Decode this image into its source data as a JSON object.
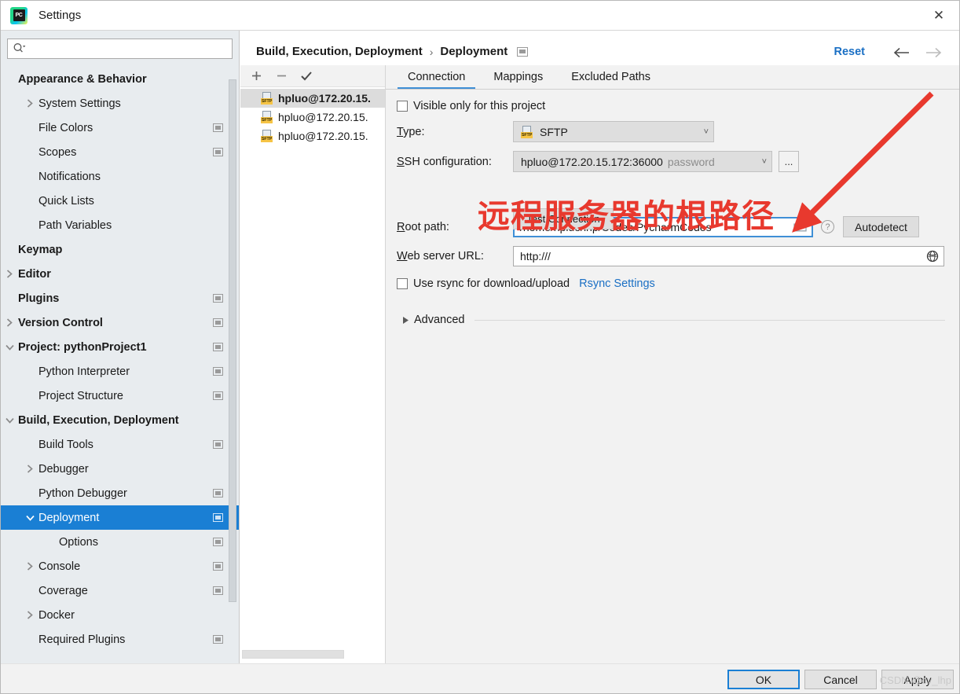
{
  "window": {
    "title": "Settings",
    "logo_text": "PC",
    "close_icon": "close-icon"
  },
  "sidebar": {
    "search": {
      "value": "",
      "placeholder": ""
    },
    "items": [
      {
        "label": "Appearance & Behavior",
        "bold": true,
        "indent": 0,
        "twisty": "none",
        "badge": false,
        "selected": false
      },
      {
        "label": "System Settings",
        "bold": false,
        "indent": 1,
        "twisty": "right",
        "badge": false,
        "selected": false
      },
      {
        "label": "File Colors",
        "bold": false,
        "indent": 1,
        "twisty": "none",
        "badge": true,
        "selected": false
      },
      {
        "label": "Scopes",
        "bold": false,
        "indent": 1,
        "twisty": "none",
        "badge": true,
        "selected": false
      },
      {
        "label": "Notifications",
        "bold": false,
        "indent": 1,
        "twisty": "none",
        "badge": false,
        "selected": false
      },
      {
        "label": "Quick Lists",
        "bold": false,
        "indent": 1,
        "twisty": "none",
        "badge": false,
        "selected": false
      },
      {
        "label": "Path Variables",
        "bold": false,
        "indent": 1,
        "twisty": "none",
        "badge": false,
        "selected": false
      },
      {
        "label": "Keymap",
        "bold": true,
        "indent": 0,
        "twisty": "none",
        "badge": false,
        "selected": false
      },
      {
        "label": "Editor",
        "bold": true,
        "indent": 0,
        "twisty": "right",
        "badge": false,
        "selected": false
      },
      {
        "label": "Plugins",
        "bold": true,
        "indent": 0,
        "twisty": "none",
        "badge": true,
        "selected": false
      },
      {
        "label": "Version Control",
        "bold": true,
        "indent": 0,
        "twisty": "right",
        "badge": true,
        "selected": false
      },
      {
        "label": "Project: pythonProject1",
        "bold": true,
        "indent": 0,
        "twisty": "down",
        "badge": true,
        "selected": false
      },
      {
        "label": "Python Interpreter",
        "bold": false,
        "indent": 1,
        "twisty": "none",
        "badge": true,
        "selected": false
      },
      {
        "label": "Project Structure",
        "bold": false,
        "indent": 1,
        "twisty": "none",
        "badge": true,
        "selected": false
      },
      {
        "label": "Build, Execution, Deployment",
        "bold": true,
        "indent": 0,
        "twisty": "down",
        "badge": false,
        "selected": false
      },
      {
        "label": "Build Tools",
        "bold": false,
        "indent": 1,
        "twisty": "none",
        "badge": true,
        "selected": false
      },
      {
        "label": "Debugger",
        "bold": false,
        "indent": 1,
        "twisty": "right",
        "badge": false,
        "selected": false
      },
      {
        "label": "Python Debugger",
        "bold": false,
        "indent": 1,
        "twisty": "none",
        "badge": true,
        "selected": false
      },
      {
        "label": "Deployment",
        "bold": false,
        "indent": 1,
        "twisty": "down",
        "badge": true,
        "selected": true
      },
      {
        "label": "Options",
        "bold": false,
        "indent": 2,
        "twisty": "none",
        "badge": true,
        "selected": false
      },
      {
        "label": "Console",
        "bold": false,
        "indent": 1,
        "twisty": "right",
        "badge": true,
        "selected": false
      },
      {
        "label": "Coverage",
        "bold": false,
        "indent": 1,
        "twisty": "none",
        "badge": true,
        "selected": false
      },
      {
        "label": "Docker",
        "bold": false,
        "indent": 1,
        "twisty": "right",
        "badge": false,
        "selected": false
      },
      {
        "label": "Required Plugins",
        "bold": false,
        "indent": 1,
        "twisty": "none",
        "badge": true,
        "selected": false
      }
    ],
    "help_icon_label": "?"
  },
  "header": {
    "breadcrumb_parent": "Build, Execution, Deployment",
    "breadcrumb_separator": "›",
    "breadcrumb_current": "Deployment",
    "reset_label": "Reset",
    "back_icon": "arrow-left-icon",
    "forward_icon": "arrow-right-icon"
  },
  "deployment_list": {
    "toolbar": {
      "add": "+",
      "remove": "−",
      "set_default": "✓"
    },
    "servers": [
      {
        "name": "hpluo@172.20.15.",
        "type": "SFTP",
        "selected": true
      },
      {
        "name": "hpluo@172.20.15.",
        "type": "SFTP",
        "selected": false
      },
      {
        "name": "hpluo@172.20.15.",
        "type": "SFTP",
        "selected": false
      }
    ]
  },
  "tabs": [
    {
      "label": "Connection",
      "active": true
    },
    {
      "label": "Mappings",
      "active": false
    },
    {
      "label": "Excluded Paths",
      "active": false
    }
  ],
  "connection": {
    "visible_only_label": "Visible only for this project",
    "visible_only_checked": false,
    "type_label": "Type:",
    "type_mnemonic": "T",
    "type_value": "SFTP",
    "ssh_label": "SSH configuration:",
    "ssh_mnemonic": "S",
    "ssh_value": "hpluo@172.20.15.172:36000",
    "ssh_auth": "password",
    "ssh_browse_button": "...",
    "test_connection_label": "Test Connection",
    "root_label": "Root path:",
    "root_mnemonic": "R",
    "root_value": "/home/hpluo/lhp/Codes/PycharmCodes",
    "root_help_icon": "question-mark-icon",
    "autodetect_label": "Autodetect",
    "weburl_label": "Web server URL:",
    "weburl_mnemonic": "W",
    "weburl_value": "http:///",
    "weburl_icon": "globe-icon",
    "rsync_label": "Use rsync for download/upload",
    "rsync_checked": false,
    "rsync_settings_link": "Rsync Settings",
    "advanced_label": "Advanced"
  },
  "annotation": {
    "text": "远程服务器的根路径",
    "color": "#e8392e",
    "arrow_icon": "red-arrow-icon"
  },
  "footer": {
    "ok_label": "OK",
    "cancel_label": "Cancel",
    "apply_label": "Apply",
    "watermark": "CSDN @cv_lhp"
  },
  "colors": {
    "accent": "#1a7fd4",
    "link": "#1a6fc4",
    "annotation_red": "#e8392e",
    "sidebar_bg": "#e8ecef",
    "panel_bg": "#f2f2f2"
  }
}
